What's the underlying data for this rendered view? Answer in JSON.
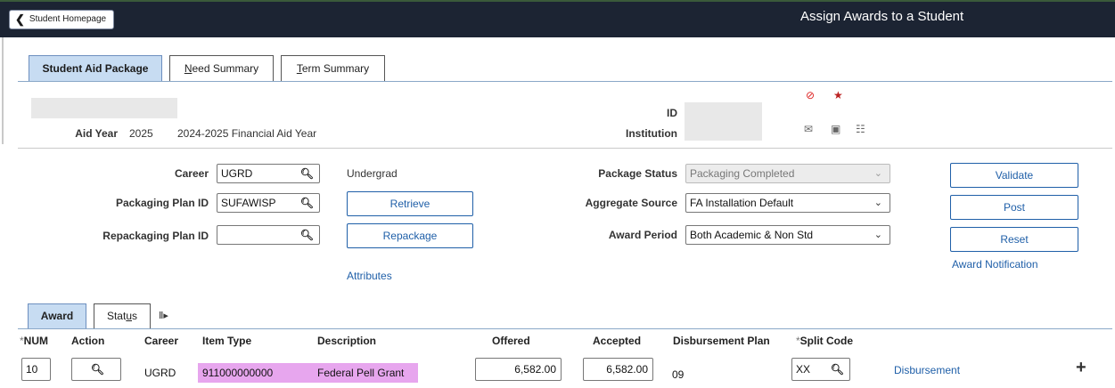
{
  "header": {
    "home_button": "Student Homepage",
    "page_title": "Assign Awards to a Student"
  },
  "tabs": [
    {
      "label": "Student Aid Package",
      "active": true
    },
    {
      "label_u": "N",
      "label_rest": "eed Summary"
    },
    {
      "label_u": "T",
      "label_rest": "erm Summary"
    }
  ],
  "student": {
    "aid_year_label": "Aid Year",
    "aid_year": "2025",
    "aid_year_desc": "2024-2025 Financial Aid Year",
    "id_label": "ID",
    "institution_label": "Institution"
  },
  "form": {
    "career_label": "Career",
    "career_value": "UGRD",
    "career_desc": "Undergrad",
    "plan_label": "Packaging Plan ID",
    "plan_value": "SUFAWISP",
    "repack_label": "Repackaging Plan ID",
    "repack_value": "",
    "retrieve_button": "Retrieve",
    "repackage_button": "Repackage",
    "attributes_link": "Attributes",
    "package_status_label": "Package Status",
    "package_status_value": "Packaging Completed",
    "aggregate_label": "Aggregate Source",
    "aggregate_value": "FA Installation Default",
    "award_period_label": "Award Period",
    "award_period_value": "Both Academic & Non Std",
    "validate_button": "Validate",
    "post_button": "Post",
    "reset_button": "Reset",
    "award_notification_link": "Award Notification"
  },
  "award_tabs": {
    "award": "Award",
    "status_pre": "Stat",
    "status_u": "u",
    "status_post": "s",
    "more_icon": "Ⅱ▸"
  },
  "grid": {
    "headers": {
      "num": "NUM",
      "action": "Action",
      "career": "Career",
      "item_type": "Item Type",
      "description": "Description",
      "offered": "Offered",
      "accepted": "Accepted",
      "disb_plan": "Disbursement Plan",
      "split_code": "Split Code"
    },
    "row": {
      "num": "10",
      "career": "UGRD",
      "item_type": "911000000000",
      "description": "Federal Pell Grant",
      "offered": "6,582.00",
      "accepted": "6,582.00",
      "disb_plan": "09",
      "split_code": "XX",
      "disbursement_link": "Disbursement"
    }
  },
  "colors": {
    "topbar": "#1c2433",
    "active_tab": "#c7dcf2",
    "link": "#1f5fa8",
    "highlight": "#e7a6ee"
  }
}
